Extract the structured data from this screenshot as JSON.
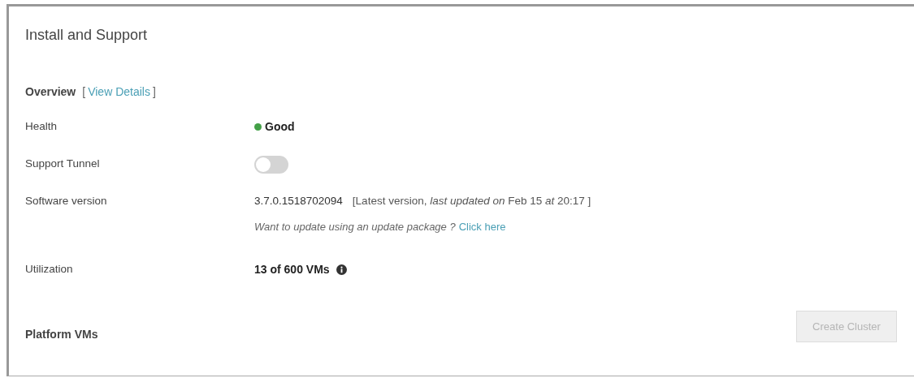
{
  "panel": {
    "title": "Install and Support"
  },
  "overview": {
    "heading": "Overview",
    "bracket_open": "[",
    "link": "View Details",
    "bracket_close": "]"
  },
  "rows": [
    {
      "kind": "status",
      "label": "Health",
      "value": "Good",
      "color": "#43a047"
    },
    {
      "kind": "toggle",
      "label": "Support Tunnel",
      "on": false
    },
    {
      "kind": "version",
      "label": "Software version",
      "version": "3.7.0.1518702094",
      "note": "[Latest version, *last updated on* Feb 15 *at* 20:17 ]",
      "hint": "Want to update using an update package ?",
      "link": "Click here"
    },
    {
      "kind": "usage",
      "label": "Utilization",
      "value": "13 of 600 VMs"
    }
  ],
  "platform": {
    "heading": "Platform VMs",
    "button": {
      "label": "Create Cluster",
      "disabled": true
    }
  }
}
